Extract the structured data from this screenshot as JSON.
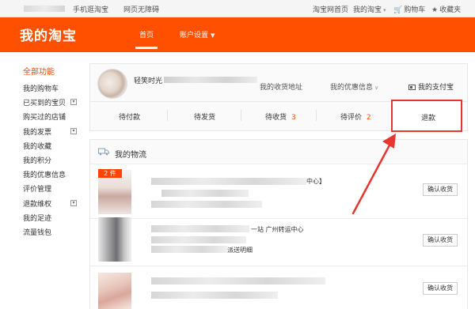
{
  "topbar": {
    "mobile_link": "手机逛淘宝",
    "accessible_link": "网页无障碍",
    "home_link": "淘宝网首页",
    "my_taobao": "我的淘宝",
    "cart": "购物车",
    "favorites": "收藏夹"
  },
  "header": {
    "logo": "我的淘宝",
    "nav_home": "首页",
    "nav_settings": "账户设置"
  },
  "sidebar": {
    "title": "全部功能",
    "items": [
      {
        "label": "我的购物车",
        "toggle": false
      },
      {
        "label": "已买到的宝贝",
        "toggle": true
      },
      {
        "label": "购买过的店铺",
        "toggle": false
      },
      {
        "label": "我的发票",
        "toggle": true
      },
      {
        "label": "我的收藏",
        "toggle": false
      },
      {
        "label": "我的积分",
        "toggle": false
      },
      {
        "label": "我的优惠信息",
        "toggle": false
      },
      {
        "label": "评价管理",
        "toggle": false
      },
      {
        "label": "退款维权",
        "toggle": true
      },
      {
        "label": "我的足迹",
        "toggle": false
      },
      {
        "label": "流量钱包",
        "toggle": false
      }
    ]
  },
  "user_panel": {
    "username": "轻笑时光",
    "address_link": "我的收货地址",
    "coupon_link": "我的优惠信息",
    "alipay_link": "我的支付宝",
    "status": [
      {
        "label": "待付款",
        "count": ""
      },
      {
        "label": "待发货",
        "count": ""
      },
      {
        "label": "待收货",
        "count": "3"
      },
      {
        "label": "待评价",
        "count": "2"
      },
      {
        "label": "退款",
        "count": ""
      }
    ]
  },
  "logistics": {
    "title": "我的物流",
    "rows": [
      {
        "badge": "2 件",
        "text_a": "中心】",
        "text_b": "",
        "button": "确认收货"
      },
      {
        "badge": "",
        "text_a": "一站 广州转运中心",
        "text_b": "派送明细",
        "button": "确认收货"
      },
      {
        "badge": "",
        "text_a": "",
        "text_b": "",
        "button": "确认收货"
      }
    ]
  },
  "colors": {
    "brand": "#ff5000",
    "highlight": "#e5362f"
  }
}
